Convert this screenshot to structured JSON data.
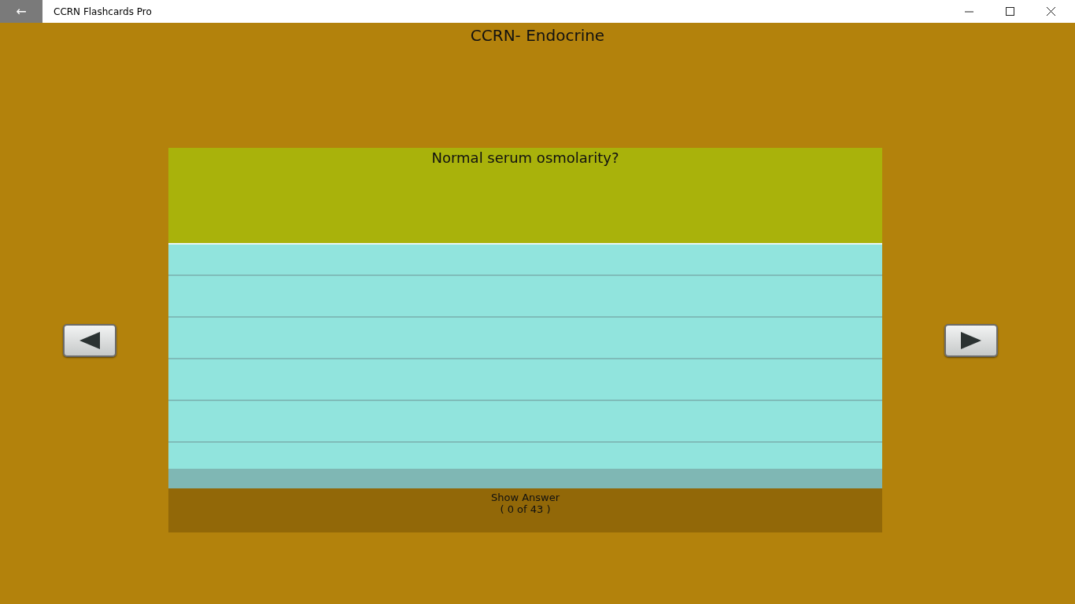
{
  "window": {
    "title": "CCRN Flashcards Pro",
    "back_icon": "←"
  },
  "deck": {
    "title": "CCRN-  Endocrine"
  },
  "card": {
    "question": "Normal serum osmolarity?",
    "show_answer": "Show Answer",
    "progress": "( 0  of 43 )"
  }
}
